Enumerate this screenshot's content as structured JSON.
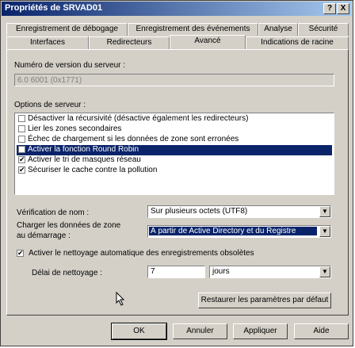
{
  "window": {
    "title": "Propriétés de SRVAD01",
    "help_btn": "?",
    "close_btn": "X"
  },
  "tabs_row1": [
    "Enregistrement de débogage",
    "Enregistrement des événements",
    "Analyse",
    "Sécurité"
  ],
  "tabs_row2": [
    "Interfaces",
    "Redirecteurs",
    "Avancé",
    "Indications de racine"
  ],
  "active_tab": "Avancé",
  "version": {
    "label": "Numéro de version du serveur :",
    "value": "6.0 6001 (0x1771)"
  },
  "options": {
    "label": "Options de serveur :",
    "items": [
      {
        "text": "Désactiver la récursivité (désactive également les redirecteurs)",
        "checked": false
      },
      {
        "text": "Lier les zones secondaires",
        "checked": false
      },
      {
        "text": "Échec de chargement si les données de zone sont erronées",
        "checked": false
      },
      {
        "text": "Activer la fonction Round Robin",
        "checked": false,
        "selected": true
      },
      {
        "text": "Activer le tri de masques réseau",
        "checked": true
      },
      {
        "text": "Sécuriser le cache contre la pollution",
        "checked": true
      }
    ]
  },
  "name_check": {
    "label": "Vérification de nom :",
    "value": "Sur plusieurs octets (UTF8)"
  },
  "zone_load": {
    "label1": "Charger les données de zone",
    "label2": "au démarrage :",
    "value": "À partir de Active Directory et du Registre"
  },
  "scavenging": {
    "label": "Activer le nettoyage automatique des enregistrements obsolètes",
    "checked": true
  },
  "interval": {
    "label": "Délai de nettoyage :",
    "value": "7",
    "unit": "jours"
  },
  "buttons": {
    "restore": "Restaurer les paramètres par défaut",
    "ok": "OK",
    "cancel": "Annuler",
    "apply": "Appliquer",
    "help": "Aide"
  },
  "glyphs": {
    "check": "✔",
    "arrow": "▼"
  }
}
